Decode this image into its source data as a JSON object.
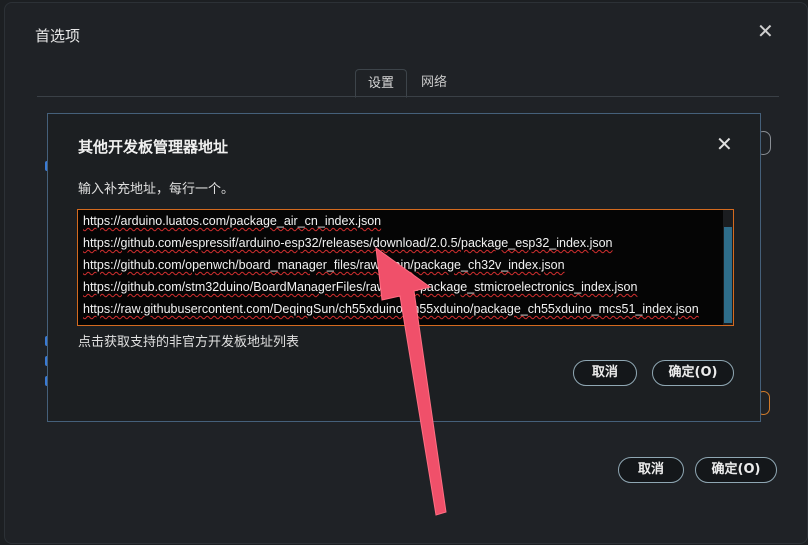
{
  "outer_dialog": {
    "title": "首选项",
    "close_icon": "close-icon",
    "tabs": [
      {
        "label": "设置",
        "active": true
      },
      {
        "label": "网络",
        "active": false
      }
    ],
    "cancel_label": "取消",
    "ok_label": "确定(O)"
  },
  "inner_dialog": {
    "title": "其他开发板管理器地址",
    "close_icon": "close-icon",
    "instruction": "输入补充地址，每行一个。",
    "urls": [
      "https://arduino.luatos.com/package_air_cn_index.json",
      "https://github.com/espressif/arduino-esp32/releases/download/2.0.5/package_esp32_index.json",
      "https://github.com/openwch/board_manager_files/raw/main/package_ch32v_index.json",
      "https://github.com/stm32duino/BoardManagerFiles/raw/main/package_stmicroelectronics_index.json",
      "https://raw.githubusercontent.com/DeqingSun/ch55xduino/ch55xduino/package_ch55xduino_mcs51_index.json"
    ],
    "link_text": "点击获取支持的非官方开发板地址列表",
    "cancel_label": "取消",
    "ok_label": "确定(O)"
  },
  "colors": {
    "accent_border": "#d46a1f",
    "dialog_border": "#45607a",
    "arrow": "#f0506a"
  },
  "annotation": {
    "icon": "red-arrow-annotation"
  }
}
